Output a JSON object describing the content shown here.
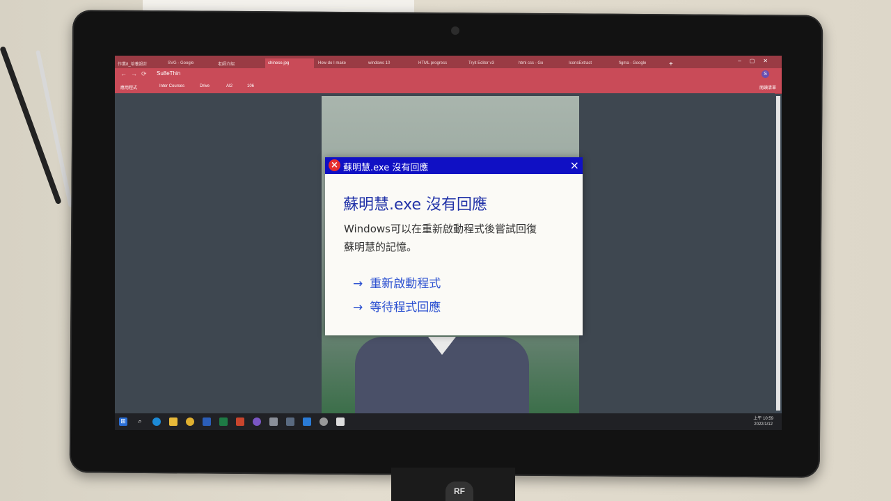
{
  "browser": {
    "tabs": [
      "作業8_培養設計",
      "SVG - Google",
      "老師介紹",
      "chinese.jpg",
      "How do I make",
      "windows 10",
      "HTML progress",
      "Tryit Editor v3",
      "html css - Go",
      "IconsExtract",
      "figma - Google"
    ],
    "active_tab_index": 3,
    "url": "Su8eThin",
    "profile_initial": "S",
    "bookmarks": [
      "應用程式",
      "Inter Courses",
      "Drive",
      "AI2",
      "106"
    ],
    "reading_list": "閱讀清單"
  },
  "taskbar": {
    "time": "上午 10:59",
    "date": "2022/1/12"
  },
  "dialog": {
    "title": "蘇明慧.exe 沒有回應",
    "heading": "蘇明慧.exe 沒有回應",
    "message_line1": "Windows可以在重新啟動程式後嘗試回復",
    "message_line2": "蘇明慧的記憶。",
    "restart_label": "重新啟動程式",
    "wait_label": "等待程式回應",
    "close_glyph": "×",
    "error_glyph": "×",
    "arrow_glyph": "→"
  },
  "stand_logo": "RF"
}
